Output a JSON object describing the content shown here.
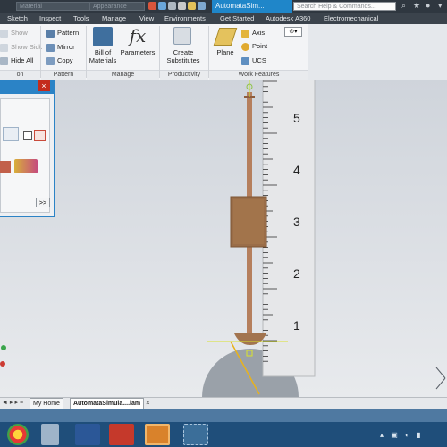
{
  "title_bar": {
    "material_field": "Material",
    "appearance_field": "Appearance",
    "document_title": "AutomataSim...",
    "search_placeholder": "Search Help & Commands..."
  },
  "menu_tabs": [
    "Sketch",
    "Inspect",
    "Tools",
    "Manage",
    "View",
    "Environments",
    "Get Started",
    "Autodesk A360",
    "Electromechanical"
  ],
  "ribbon": {
    "pattern_tools": [
      "Show",
      "Show Sick",
      "Hide All"
    ],
    "pattern_panel": {
      "pattern": "Pattern",
      "mirror": "Mirror",
      "copy": "Copy"
    },
    "bill_of_materials": "Bill of\nMaterials",
    "parameters": "Parameters",
    "create_substitutes": "Create\nSubstitutes",
    "plane": "Plane",
    "axis": "Axis",
    "point": "Point",
    "ucs": "UCS",
    "panel_labels": {
      "position": "on",
      "pattern": "Pattern",
      "manage": "Manage",
      "productivity": "Productivity",
      "work_features": "Work Features"
    }
  },
  "dialog": {
    "close": "×",
    "expand": ">>"
  },
  "ruler": {
    "numbers": [
      "5",
      "4",
      "3",
      "2",
      "1"
    ]
  },
  "doc_tabs": {
    "home": "My Home",
    "assembly": "AutomataSimula....iam"
  },
  "colors": {
    "title_bar": "#2f3740",
    "active_tab": "#1f86c9",
    "ribbon": "#f3f4f6",
    "viewport_top": "#cfd4db",
    "rod": "#b57f5d",
    "block": "#9a6d48",
    "ruler": "#e6e7e9",
    "taskbar": "#1f4e7a"
  }
}
